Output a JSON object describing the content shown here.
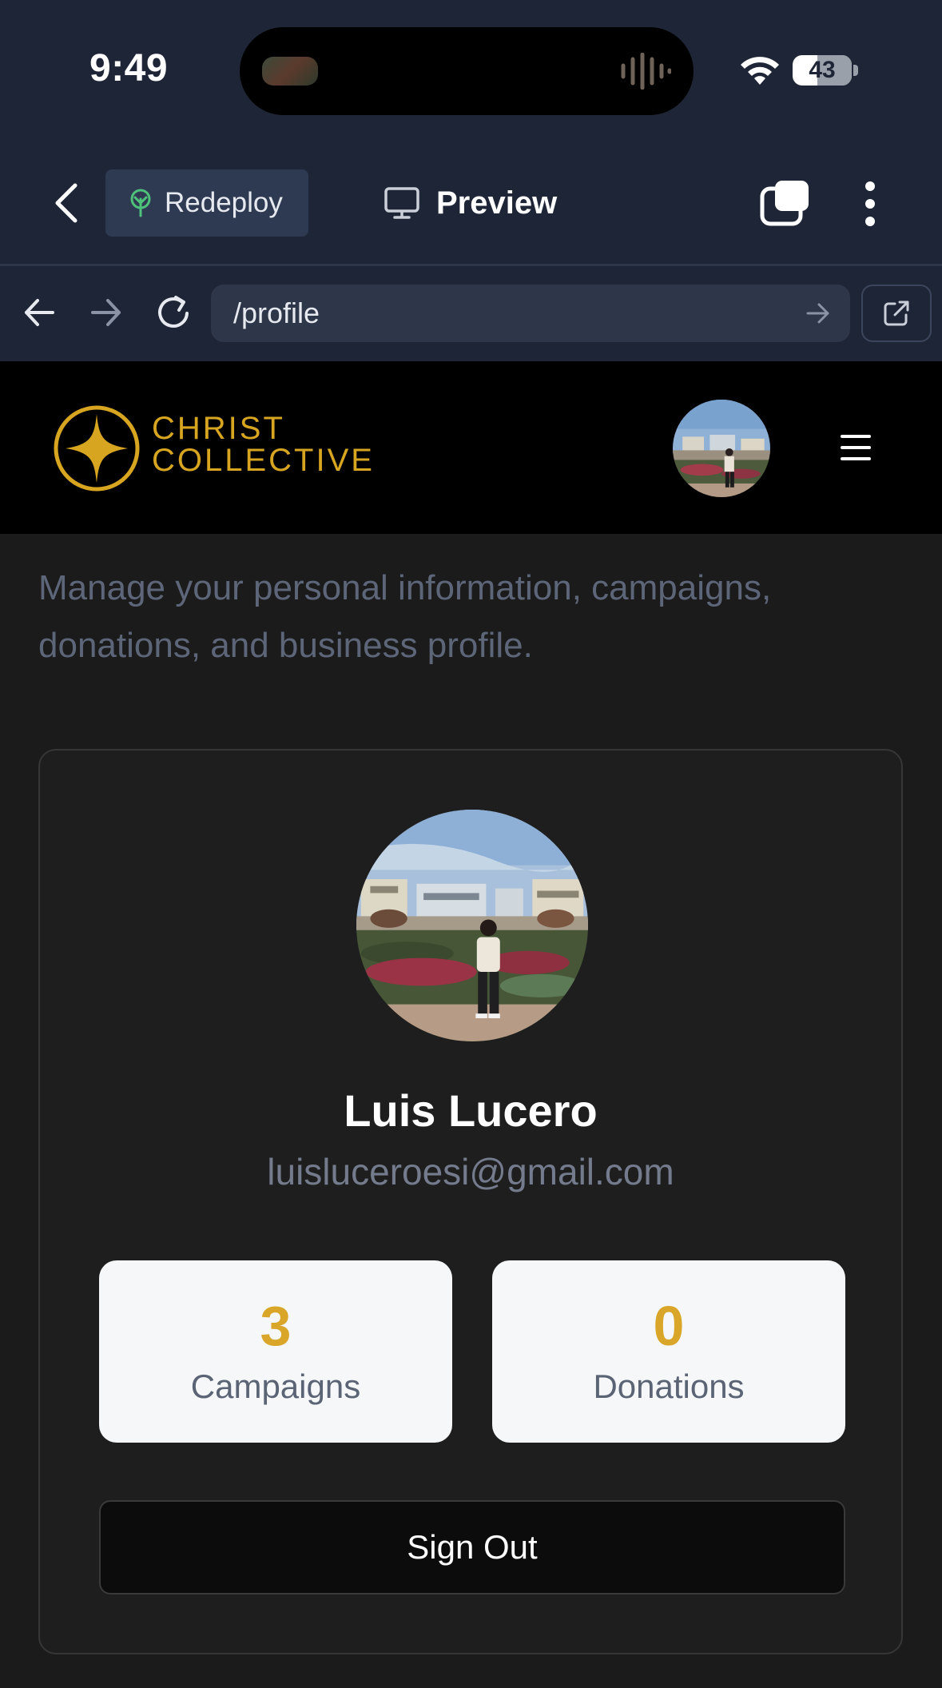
{
  "status_bar": {
    "time": "9:49",
    "battery_percent": "43",
    "battery_level": 0.43
  },
  "app_bar": {
    "redeploy_label": "Redeploy",
    "preview_label": "Preview"
  },
  "browser": {
    "url": "/profile"
  },
  "site_header": {
    "logo_line1": "CHRIST",
    "logo_line2": "COLLECTIVE",
    "brand_color": "#d8a520"
  },
  "page": {
    "intro_text": "Manage your personal information, campaigns, donations, and business profile."
  },
  "profile": {
    "name": "Luis Lucero",
    "email": "luisluceroesi@gmail.com",
    "stats": [
      {
        "value": "3",
        "label": "Campaigns"
      },
      {
        "value": "0",
        "label": "Donations"
      }
    ],
    "sign_out_label": "Sign Out",
    "accent_color": "#d9a62a"
  }
}
